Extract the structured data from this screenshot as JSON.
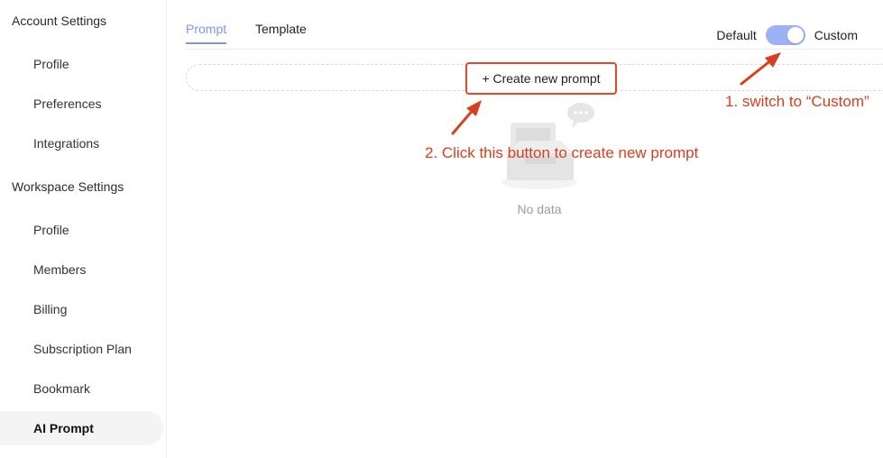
{
  "sidebar": {
    "account_title": "Account Settings",
    "account_items": [
      {
        "label": "Profile"
      },
      {
        "label": "Preferences"
      },
      {
        "label": "Integrations"
      }
    ],
    "workspace_title": "Workspace Settings",
    "workspace_items": [
      {
        "label": "Profile"
      },
      {
        "label": "Members"
      },
      {
        "label": "Billing"
      },
      {
        "label": "Subscription Plan"
      },
      {
        "label": "Bookmark"
      },
      {
        "label": "AI Prompt"
      }
    ],
    "active_item": "AI Prompt"
  },
  "tabs": [
    {
      "label": "Prompt",
      "active": true
    },
    {
      "label": "Template",
      "active": false
    }
  ],
  "toggle": {
    "left_label": "Default",
    "right_label": "Custom",
    "state": "Custom"
  },
  "create_button": {
    "label": "+ Create new prompt"
  },
  "empty_state": {
    "text": "No data",
    "icon": "empty-inbox-icon"
  },
  "annotations": {
    "step1": "1. switch to “Custom”",
    "step2": "2. Click this button to create new prompt"
  },
  "colors": {
    "accent": "#7b97e8",
    "toggle_on": "#9db2f4",
    "annotation": "#d6401f",
    "highlight_border": "#e04a2b"
  }
}
